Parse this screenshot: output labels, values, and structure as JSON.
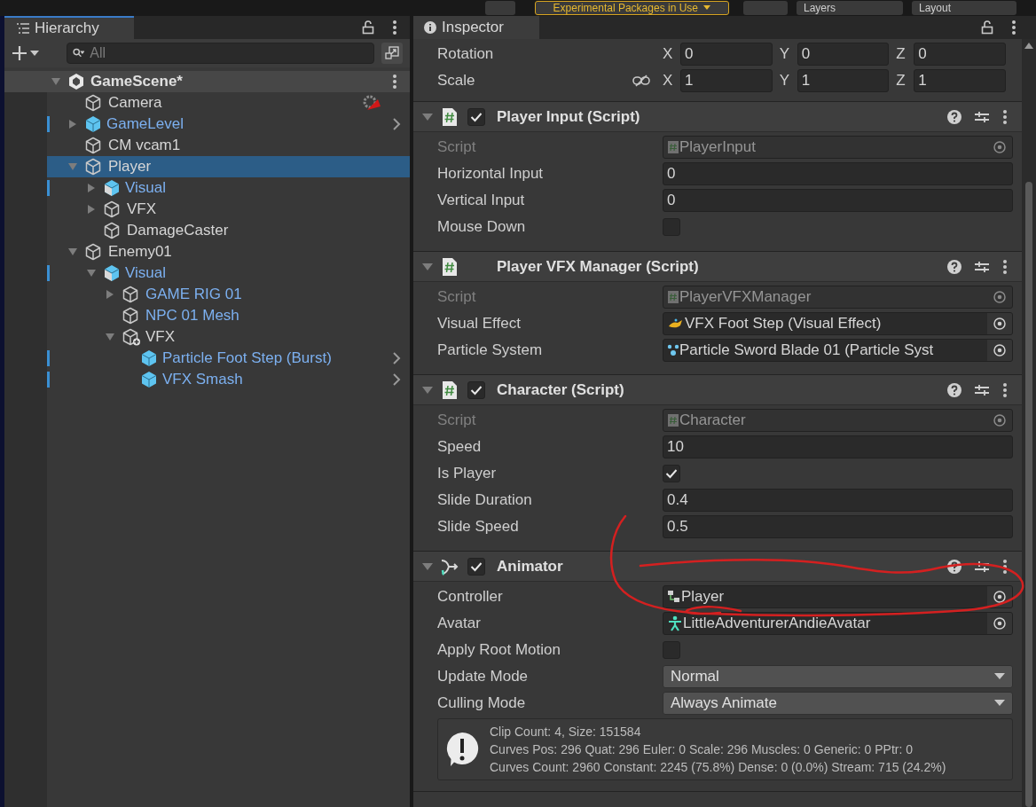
{
  "toolbar": {
    "packages_button": "Experimental Packages in Use",
    "layers": "Layers",
    "layout": "Layout"
  },
  "hierarchy": {
    "title": "Hierarchy",
    "search": {
      "placeholder": "All"
    },
    "scene": {
      "name": "GameScene*",
      "expanded": true
    },
    "items": [
      {
        "name": "Camera",
        "kind": "gameobject",
        "prefab_root": false,
        "prefab_instance": false,
        "selected": false,
        "warning_badge": true
      },
      {
        "name": "GameLevel",
        "kind": "prefab",
        "prefab_root": true,
        "prefab_instance": true,
        "selected": false,
        "expanded": false,
        "open_arrow": true
      },
      {
        "name": "CM vcam1",
        "kind": "gameobject",
        "prefab_root": false,
        "prefab_instance": false,
        "selected": false
      },
      {
        "name": "Player",
        "kind": "gameobject",
        "prefab_root": false,
        "prefab_instance": false,
        "selected": true,
        "expanded": true,
        "children": [
          {
            "name": "Visual",
            "kind": "model",
            "prefab_root": true,
            "prefab_instance": true,
            "selected": false,
            "expanded": false
          },
          {
            "name": "VFX",
            "kind": "gameobject",
            "prefab_root": false,
            "prefab_instance": false,
            "selected": false,
            "expanded": false
          },
          {
            "name": "DamageCaster",
            "kind": "gameobject",
            "prefab_root": false,
            "prefab_instance": false,
            "selected": false
          }
        ]
      },
      {
        "name": "Enemy01",
        "kind": "gameobject",
        "prefab_root": false,
        "prefab_instance": false,
        "selected": false,
        "expanded": true,
        "children": [
          {
            "name": "Visual",
            "kind": "model",
            "prefab_root": true,
            "prefab_instance": true,
            "selected": false,
            "expanded": true,
            "children": [
              {
                "name": "GAME RIG 01",
                "kind": "gameobject",
                "prefab_root": false,
                "prefab_instance": true,
                "selected": false,
                "expanded": false
              },
              {
                "name": "NPC 01 Mesh",
                "kind": "gameobject",
                "prefab_root": false,
                "prefab_instance": true,
                "selected": false
              },
              {
                "name": "VFX",
                "kind": "added",
                "prefab_root": false,
                "prefab_instance": false,
                "selected": false,
                "expanded": true,
                "children": [
                  {
                    "name": "Particle Foot Step (Burst)",
                    "kind": "prefab",
                    "prefab_root": true,
                    "prefab_instance": true,
                    "selected": false,
                    "open_arrow": true
                  },
                  {
                    "name": "VFX Smash",
                    "kind": "prefab",
                    "prefab_root": true,
                    "prefab_instance": true,
                    "selected": false,
                    "open_arrow": true
                  }
                ]
              }
            ]
          }
        ]
      }
    ]
  },
  "inspector": {
    "title": "Inspector",
    "transform": [
      {
        "label": "Rotation",
        "linked": false,
        "axes": [
          {
            "axis": "X",
            "value": "0"
          },
          {
            "axis": "Y",
            "value": "0"
          },
          {
            "axis": "Z",
            "value": "0"
          }
        ]
      },
      {
        "label": "Scale",
        "linked": true,
        "axes": [
          {
            "axis": "X",
            "value": "1"
          },
          {
            "axis": "Y",
            "value": "1"
          },
          {
            "axis": "Z",
            "value": "1"
          }
        ]
      }
    ],
    "components": [
      {
        "title": "Player Input (Script)",
        "kind": "script",
        "enabled": true,
        "fields": [
          {
            "label": "Script",
            "kind": "script_ref",
            "value": "PlayerInput",
            "disabled": true
          },
          {
            "label": "Horizontal Input",
            "kind": "text",
            "value": "0"
          },
          {
            "label": "Vertical Input",
            "kind": "text",
            "value": "0"
          },
          {
            "label": "Mouse Down",
            "kind": "checkbox",
            "checked": false
          }
        ]
      },
      {
        "title": "Player VFX Manager (Script)",
        "kind": "script",
        "fields": [
          {
            "label": "Script",
            "kind": "script_ref",
            "value": "PlayerVFXManager",
            "disabled": true
          },
          {
            "label": "Visual Effect",
            "kind": "effect_ref",
            "value": "VFX Foot Step (Visual Effect)",
            "disabled": false
          },
          {
            "label": "Particle System",
            "kind": "particle_ref",
            "value": "Particle Sword Blade 01 (Particle Syst",
            "disabled": false
          }
        ]
      },
      {
        "title": "Character (Script)",
        "kind": "script",
        "enabled": true,
        "fields": [
          {
            "label": "Script",
            "kind": "script_ref",
            "value": "Character",
            "disabled": true
          },
          {
            "label": "Speed",
            "kind": "text",
            "value": "10"
          },
          {
            "label": "Is Player",
            "kind": "checkbox",
            "checked": true
          },
          {
            "label": "Slide Duration",
            "kind": "text",
            "value": "0.4"
          },
          {
            "label": "Slide Speed",
            "kind": "text",
            "value": "0.5"
          }
        ]
      },
      {
        "title": "Animator",
        "kind": "animator",
        "enabled": true,
        "fields": [
          {
            "label": "Controller",
            "kind": "controller_ref",
            "value": "Player",
            "disabled": false
          },
          {
            "label": "Avatar",
            "kind": "avatar_ref",
            "value": "LittleAdventurerAndieAvatar",
            "disabled": false
          },
          {
            "label": "Apply Root Motion",
            "kind": "checkbox",
            "checked": false
          },
          {
            "label": "Update Mode",
            "kind": "dropdown",
            "value": "Normal"
          },
          {
            "label": "Culling Mode",
            "kind": "dropdown",
            "value": "Always Animate"
          }
        ],
        "info": [
          "Clip Count: 4, Size: 151584",
          "Curves Pos: 296 Quat: 296 Euler: 0 Scale: 296 Muscles: 0 Generic: 0 PPtr: 0",
          "Curves Count: 2960 Constant: 2245 (75.8%) Dense: 0 (0.0%) Stream: 715 (24.2%)"
        ]
      }
    ]
  }
}
